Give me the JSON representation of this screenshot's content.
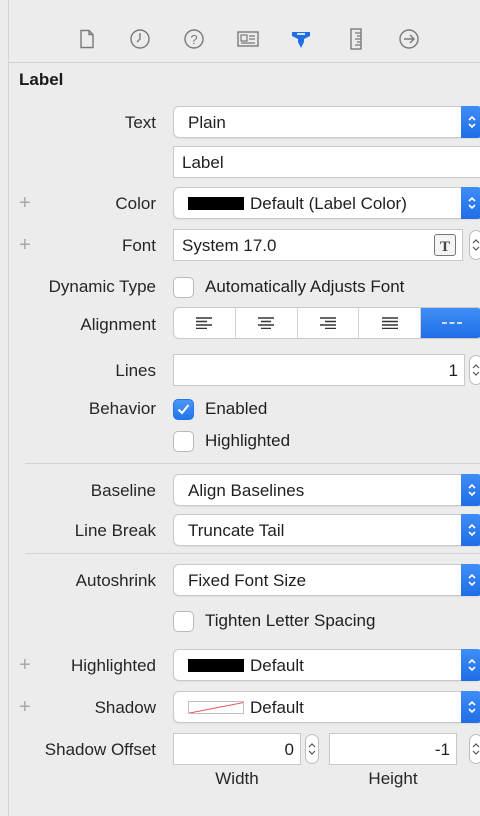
{
  "toolbar": {
    "icons": [
      {
        "name": "file-icon",
        "active": false
      },
      {
        "name": "clock-icon",
        "active": false
      },
      {
        "name": "help-icon",
        "active": false
      },
      {
        "name": "identity-icon",
        "active": false
      },
      {
        "name": "attributes-icon",
        "active": true
      },
      {
        "name": "ruler-icon",
        "active": false
      },
      {
        "name": "connections-icon",
        "active": false
      }
    ],
    "accent": "#1f6ee6"
  },
  "section": {
    "title": "Label"
  },
  "text": {
    "label": "Text",
    "type": "Plain",
    "value": "Label"
  },
  "color": {
    "label": "Color",
    "value": "Default (Label Color)"
  },
  "font": {
    "label": "Font",
    "value": "System 17.0"
  },
  "dynamic_type": {
    "label": "Dynamic Type",
    "option": "Automatically Adjusts Font",
    "checked": false
  },
  "alignment": {
    "label": "Alignment",
    "options": [
      "left",
      "center",
      "right",
      "justified",
      "natural"
    ],
    "selected": "natural"
  },
  "lines": {
    "label": "Lines",
    "value": "1"
  },
  "behavior": {
    "label": "Behavior",
    "enabled_label": "Enabled",
    "enabled": true,
    "highlighted_label": "Highlighted",
    "highlighted": false
  },
  "baseline": {
    "label": "Baseline",
    "value": "Align Baselines"
  },
  "line_break": {
    "label": "Line Break",
    "value": "Truncate Tail"
  },
  "autoshrink": {
    "label": "Autoshrink",
    "value": "Fixed Font Size",
    "tighten_label": "Tighten Letter Spacing",
    "tighten": false
  },
  "highlighted": {
    "label": "Highlighted",
    "value": "Default"
  },
  "shadow": {
    "label": "Shadow",
    "value": "Default"
  },
  "shadow_offset": {
    "label": "Shadow Offset",
    "width_value": "0",
    "height_value": "-1",
    "width_label": "Width",
    "height_label": "Height"
  }
}
